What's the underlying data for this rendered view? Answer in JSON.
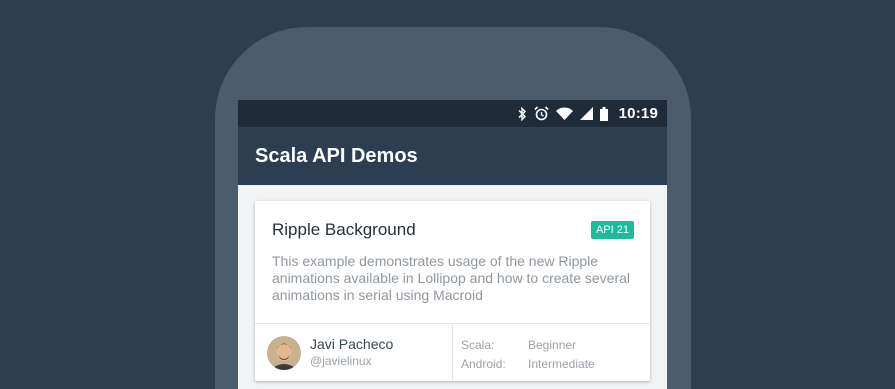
{
  "status_bar": {
    "time": "10:19",
    "icons": [
      "bluetooth-icon",
      "alarm-icon",
      "wifi-icon",
      "signal-icon",
      "battery-icon"
    ]
  },
  "app_bar": {
    "title": "Scala API Demos"
  },
  "card": {
    "title": "Ripple Background",
    "badge": "API 21",
    "description": "This example demonstrates usage of the new Ripple animations available in Lollipop and how to create several animations in serial using Macroid",
    "author": {
      "name": "Javi Pacheco",
      "handle": "@javielinux"
    },
    "levels": [
      {
        "label": "Scala:",
        "value": "Beginner"
      },
      {
        "label": "Android:",
        "value": "Intermediate"
      }
    ]
  },
  "colors": {
    "background": "#2e3e52",
    "status_bar": "#1f2b38",
    "badge": "#1abc9c"
  }
}
